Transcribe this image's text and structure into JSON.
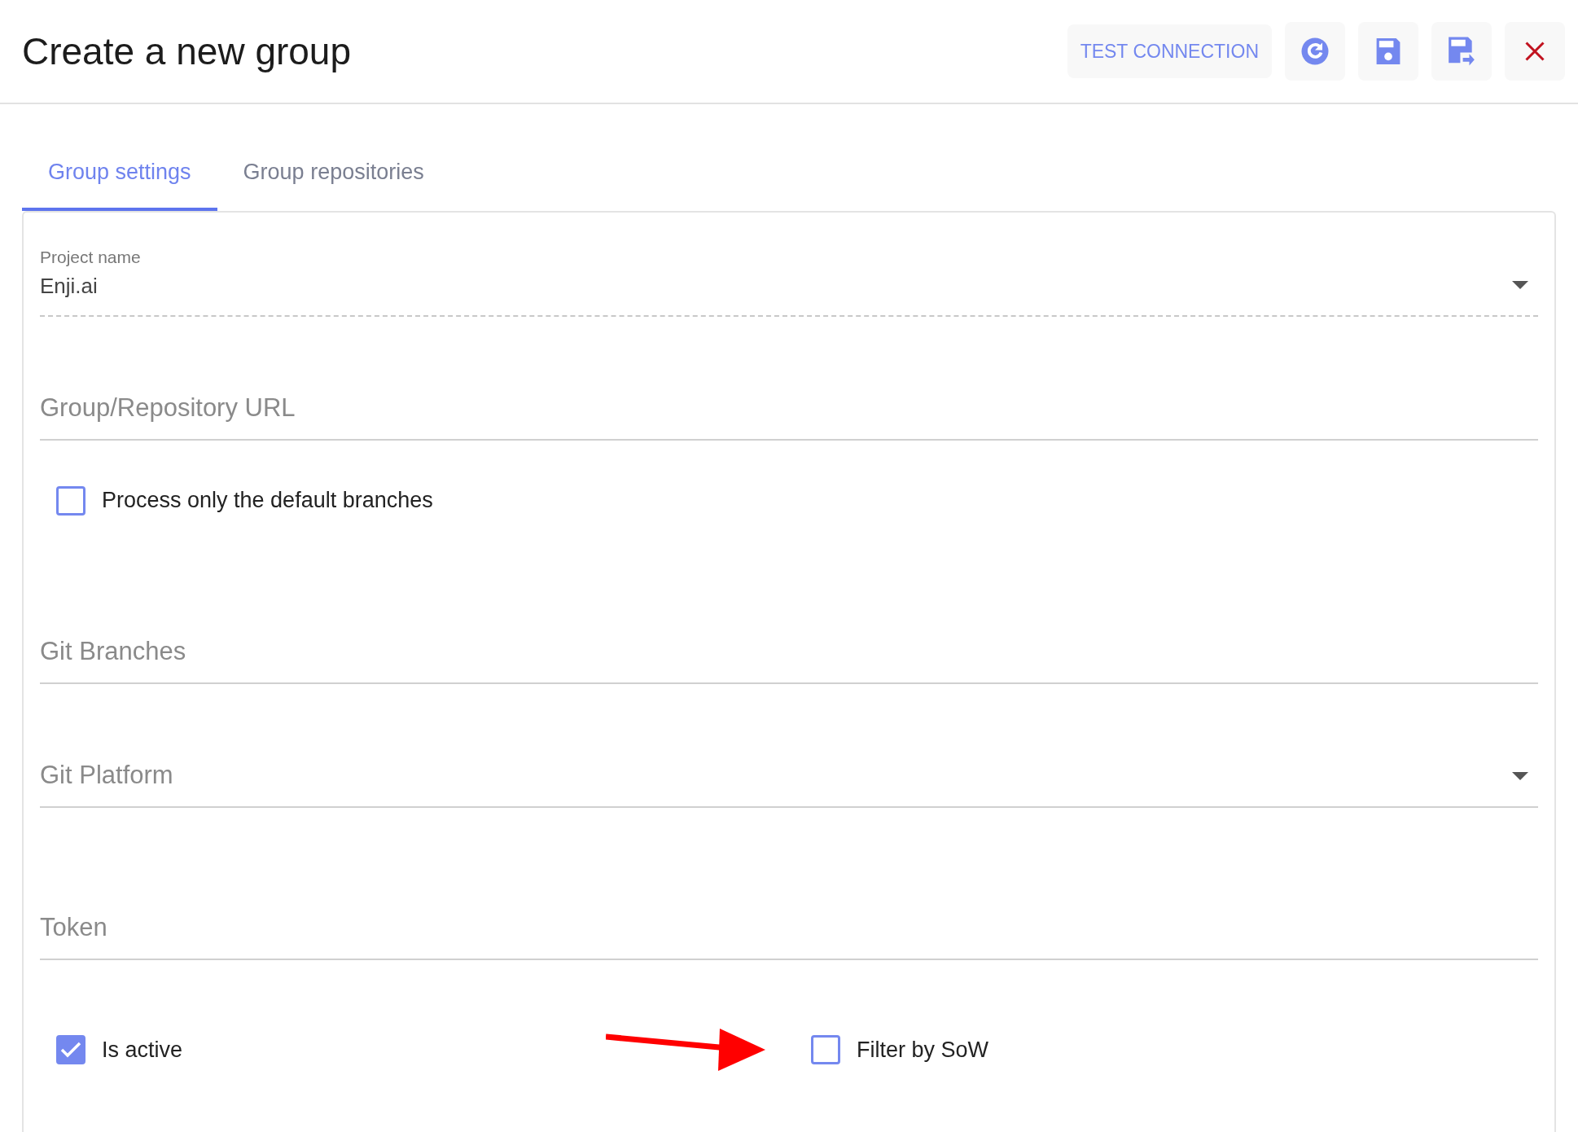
{
  "header": {
    "title": "Create a new group",
    "buttons": [
      {
        "kind": "text",
        "label": "TEST CONNECTION"
      },
      {
        "kind": "refresh"
      },
      {
        "kind": "save"
      },
      {
        "kind": "save-as"
      },
      {
        "kind": "close"
      }
    ]
  },
  "tabs": [
    {
      "label": "Group settings",
      "selected": true
    },
    {
      "label": "Group repositories",
      "selected": false
    }
  ],
  "form": [
    {
      "kind": "select",
      "label": "Project name",
      "value": "Enji.ai",
      "disabled": true
    },
    {
      "kind": "text",
      "placeholder": "Group/Repository URL"
    },
    {
      "kind": "checkbox",
      "label": "Process only the default branches",
      "checked": false
    },
    {
      "kind": "text",
      "placeholder": "Git Branches"
    },
    {
      "kind": "select",
      "placeholder": "Git Platform"
    },
    {
      "kind": "text",
      "placeholder": "Token"
    }
  ],
  "bottom_checkboxes": [
    {
      "label": "Is active",
      "checked": true
    },
    {
      "label": "Filter by SoW",
      "checked": false,
      "annotated": true
    }
  ]
}
